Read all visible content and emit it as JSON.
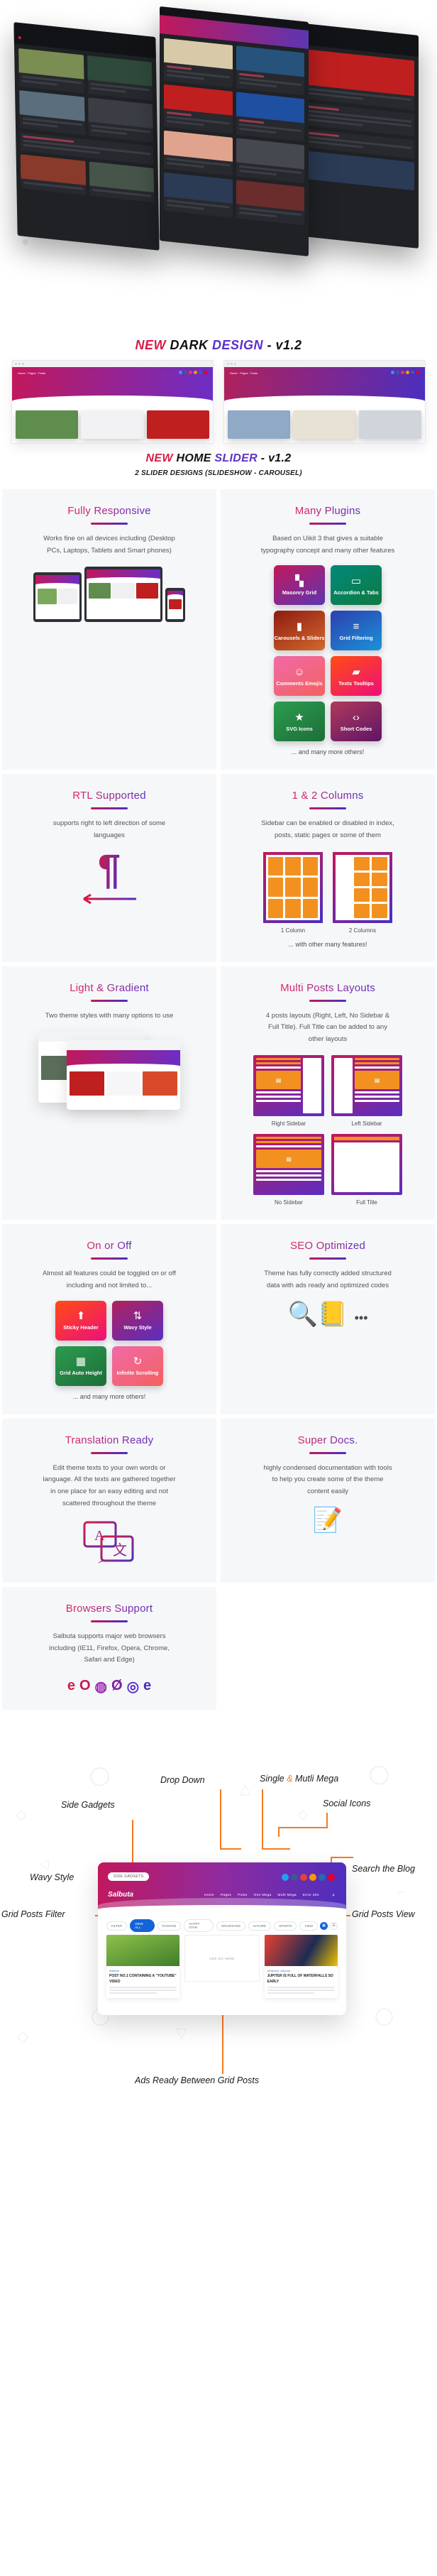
{
  "hero": {
    "title_parts": [
      {
        "text": "NEW ",
        "color": "#d81b46"
      },
      {
        "text": "DARK ",
        "color": "#111111"
      },
      {
        "text": "DESIGN",
        "color": "#5a32c8"
      },
      {
        "text": " - v1.2",
        "color": "#111111"
      }
    ],
    "title_plain": "NEW DARK DESIGN - v1.2"
  },
  "slider_section": {
    "title_parts": [
      {
        "text": "NEW ",
        "color": "#d81b46"
      },
      {
        "text": "HOME ",
        "color": "#111111"
      },
      {
        "text": "SLIDER",
        "color": "#5a32c8"
      },
      {
        "text": " - v1.2",
        "color": "#111111"
      }
    ],
    "subtitle": "2 SLIDER DESIGNS (SLIDESHOW - CAROUSEL)"
  },
  "features": [
    {
      "id": "fully-responsive",
      "title": "Fully Responsive",
      "body": "Works fine on all devices including (Desktop PCs, Laptops, Tablets and Smart phones)"
    },
    {
      "id": "many-plugins",
      "title": "Many Plugins",
      "body": "Based on Uikit 3 that gives a suitable typography concept and many other features",
      "footer": "... and many more others!",
      "tiles": [
        {
          "label": "Masonry Grid",
          "icon": "grid-icon",
          "glyph": "▚",
          "from": "#c2185b",
          "to": "#5e35b1"
        },
        {
          "label": "Accordion & Tabs",
          "icon": "folder-icon",
          "glyph": "▭",
          "from": "#00897b",
          "to": "#0f7a42"
        },
        {
          "label": "Carousels & Sliders",
          "icon": "carousel-icon",
          "glyph": "▮",
          "from": "#8e1b12",
          "to": "#d2692c"
        },
        {
          "label": "Grid Filtering",
          "icon": "filter-lines-icon",
          "glyph": "≡",
          "from": "#2d3fae",
          "to": "#1b92d8"
        },
        {
          "label": "Comments Emojis",
          "icon": "smiley-icon",
          "glyph": "☺",
          "from": "#f06aa8",
          "to": "#f4615f"
        },
        {
          "label": "Texts Tooltips",
          "icon": "chat-bubble-icon",
          "glyph": "▰",
          "from": "#ff4d12",
          "to": "#ed0f7a"
        },
        {
          "label": "SVG Icons",
          "icon": "star-icon",
          "glyph": "★",
          "from": "#2c9c4f",
          "to": "#1d6e38"
        },
        {
          "label": "Short Codes",
          "icon": "code-icon",
          "glyph": "‹›",
          "from": "#b03a5b",
          "to": "#5e1466"
        }
      ]
    },
    {
      "id": "rtl-supported",
      "title": "RTL Supported",
      "body": "supports right to left direction of some languages",
      "glyph": "¶"
    },
    {
      "id": "one-two-columns",
      "title": "1 & 2 Columns",
      "body": "Sidebar can be enabled or disabled in index, posts, static pages or some of them",
      "footer": "... with other many features!",
      "diagram_captions": [
        "1 Column",
        "2 Columns"
      ]
    },
    {
      "id": "light-and-gradient",
      "title": "Light & Gradient",
      "body": "Two theme styles with many options to use"
    },
    {
      "id": "multi-posts-layouts",
      "title": "Multi Posts Layouts",
      "body": "4 posts layouts (Right, Left, No Sidebar & Full Title). Full Title can be added to any other layouts",
      "layout_captions": [
        "Right Sidebar",
        "Left Sidebar",
        "No Sidebar",
        "Full Title"
      ]
    },
    {
      "id": "on-or-off",
      "title": "On or Off",
      "body": "Almost all features could be toggled on or off including and not limited to...",
      "footer": "... and many more others!",
      "tiles": [
        {
          "label": "Sticky Header",
          "icon": "arrow-up-bar-icon",
          "glyph": "⬆",
          "from": "#ff4d12",
          "to": "#ed0f7a"
        },
        {
          "label": "Wavy Style",
          "icon": "wave-arrows-icon",
          "glyph": "⇅",
          "from": "#b0215c",
          "to": "#5b2ec0"
        },
        {
          "label": "Grid Auto Height",
          "icon": "layout-blocks-icon",
          "glyph": "▦",
          "from": "#2c9c4f",
          "to": "#1d6e38"
        },
        {
          "label": "Infinite Scrolling",
          "icon": "refresh-icon",
          "glyph": "↻",
          "from": "#f06aa8",
          "to": "#f4615f"
        }
      ]
    },
    {
      "id": "translation-ready",
      "title": "Translation Ready",
      "body": "Edit theme texts to your own words or language. All the texts are gathered together in one place for an easy editing and not scattered throughout the theme"
    },
    {
      "id": "seo-optimized",
      "title": "SEO Optimized",
      "body": "Theme has fully correctly added structured data with ads ready and optimized codes"
    },
    {
      "id": "super-docs",
      "title": "Super Docs.",
      "body": "highly condensed documentation with tools to help you create some of the theme content easily"
    },
    {
      "id": "browsers-support",
      "title": "Browsers Support",
      "body": "Salbuta supports major web browsers including (IE11, Firefox, Opera, Chrome, Safari and Edge)",
      "browser_icons": [
        "internet-explorer-icon",
        "opera-icon",
        "chrome-icon",
        "firefox-icon",
        "safari-icon",
        "edge-icon"
      ]
    }
  ],
  "annotations": {
    "side_gadgets": "Side Gadgets",
    "drop_down": "Drop Down",
    "single_multi_mega_pre": "Single ",
    "single_multi_mega_amp": "&",
    "single_multi_mega_post": " Mutli Mega",
    "social_icons": "Social Icons",
    "wavy_style": "Wavy Style",
    "search_the_blog": "Search the Blog",
    "grid_posts_filter": "Grid Posts Filter",
    "grid_posts_view": "Grid Posts View",
    "ads_ready": "Ads Ready Between Grid Posts"
  },
  "browser_mock": {
    "side_gadgets_pill": "SIDE GADGETS",
    "brand": "Salbuta",
    "menu": [
      "Home",
      "Pages",
      "Posts",
      "One Mega",
      "Multi Mega",
      "Error 404"
    ],
    "filter_button": "FILTER",
    "chips": [
      "VIEW ALL",
      "FASHION",
      "HAPPY STAR",
      "MOUNTAINS",
      "NATURE",
      "SPORTS"
    ],
    "view_button": "VIEW",
    "ads_placeholder": "ADS GO HERE",
    "posts": [
      {
        "tag": "#Nature",
        "title": "POST NO.1 CONTAINING A \"YOUTUBE\" VIDEO"
      },
      {
        "tag": "#Fashion, #Sports",
        "title": "JUPITER IS FULL OF WATERFALLS SO EARLY"
      }
    ]
  },
  "colors": {
    "accent_red": "#d81b46",
    "accent_purple": "#5a32c8",
    "orange": "#f47b20",
    "panel_bg": "#f6f7f9"
  }
}
